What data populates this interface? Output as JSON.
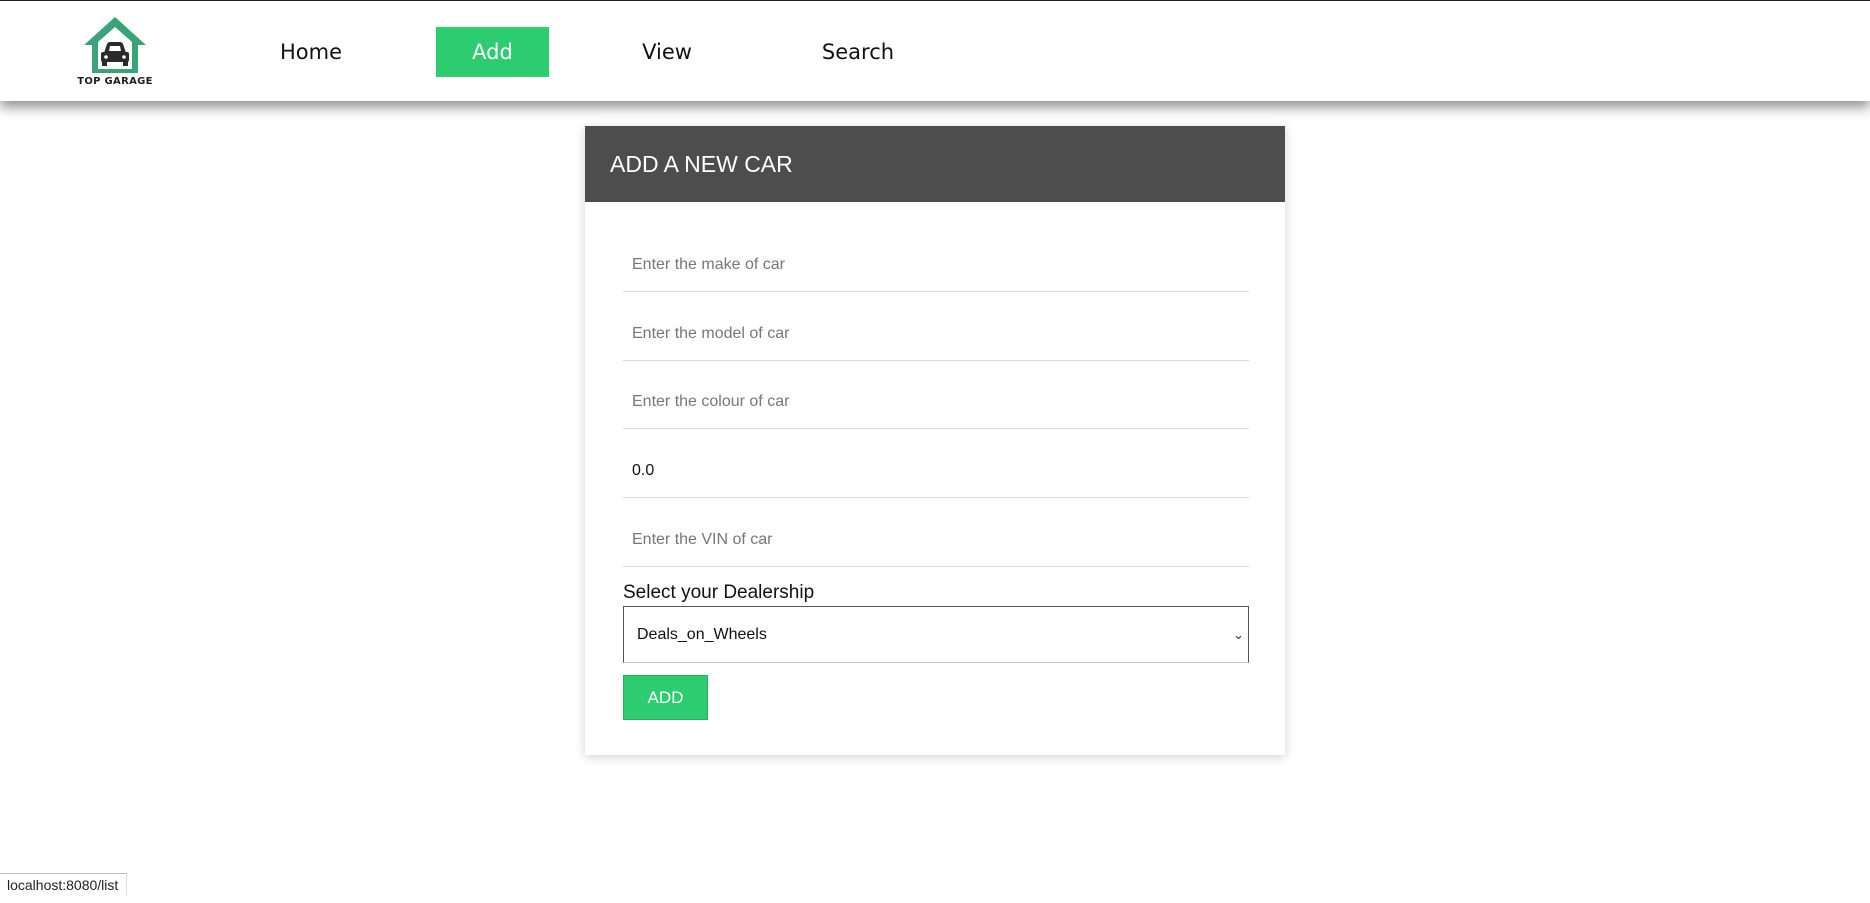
{
  "brand": {
    "name": "TOP GARAGE",
    "accent": "#2ecc71",
    "icon": "garage-car-icon"
  },
  "nav": [
    {
      "label": "Home",
      "active": false
    },
    {
      "label": "Add",
      "active": true
    },
    {
      "label": "View",
      "active": false
    },
    {
      "label": "Search",
      "active": false
    }
  ],
  "form": {
    "title": "ADD A NEW CAR",
    "make_placeholder": "Enter the make of car",
    "model_placeholder": "Enter the model of car",
    "colour_placeholder": "Enter the colour of car",
    "price_value": "0.0",
    "vin_placeholder": "Enter the VIN of car",
    "dealership_label": "Select your Dealership",
    "dealership_selected": "Deals_on_Wheels",
    "submit_label": "ADD"
  },
  "status_bar": {
    "url": "localhost:8080/list"
  }
}
